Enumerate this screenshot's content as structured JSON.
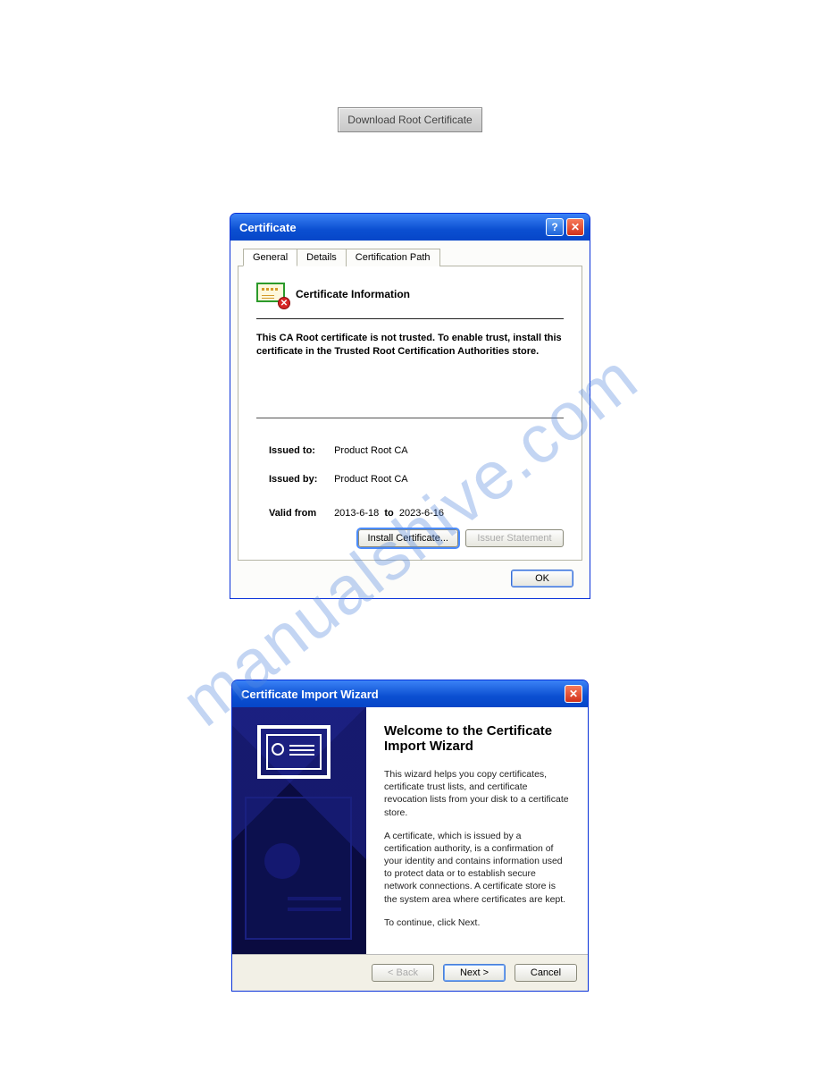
{
  "watermark": "manualshive.com",
  "download_button": "Download Root Certificate",
  "cert_dialog": {
    "title": "Certificate",
    "tabs": [
      "General",
      "Details",
      "Certification Path"
    ],
    "active_tab": 0,
    "info_heading": "Certificate Information",
    "trust_message": "This CA Root certificate is not trusted. To enable trust, install this certificate in the Trusted Root Certification Authorities store.",
    "issued_to_label": "Issued to:",
    "issued_to_value": "Product Root CA",
    "issued_by_label": "Issued by:",
    "issued_by_value": "Product Root CA",
    "valid_from_label": "Valid from",
    "valid_from_value": "2013-6-18",
    "valid_to_label": "to",
    "valid_to_value": "2023-6-16",
    "install_button": "Install Certificate...",
    "issuer_button": "Issuer Statement",
    "ok_button": "OK"
  },
  "wizard_dialog": {
    "title": "Certificate Import Wizard",
    "heading": "Welcome to the Certificate Import Wizard",
    "para1": "This wizard helps you copy certificates, certificate trust lists, and certificate revocation lists from your disk to a certificate store.",
    "para2": "A certificate, which is issued by a certification authority, is a confirmation of your identity and contains information used to protect data or to establish secure network connections. A certificate store is the system area where certificates are kept.",
    "para3": "To continue, click Next.",
    "back_button": "< Back",
    "next_button": "Next >",
    "cancel_button": "Cancel"
  }
}
